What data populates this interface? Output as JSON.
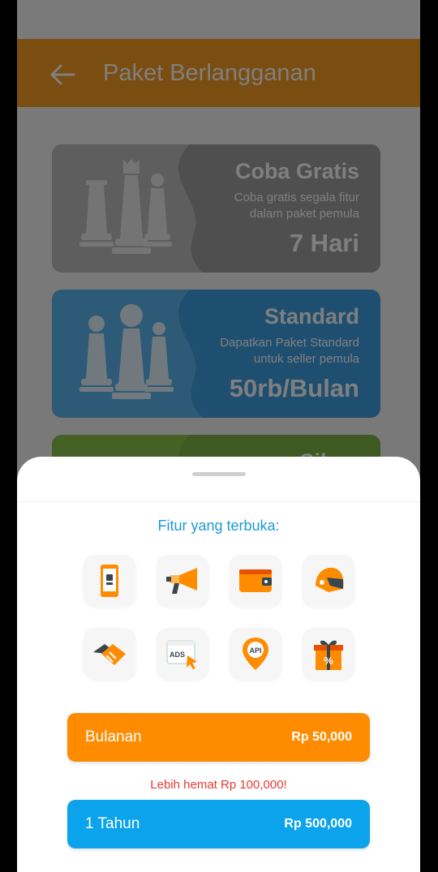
{
  "header": {
    "title": "Paket Berlangganan",
    "back_icon": "arrow-left-icon"
  },
  "plans": [
    {
      "name": "Coba Gratis",
      "desc_line1": "Coba gratis segala fitur",
      "desc_line2": "dalam paket pemula",
      "price": "7 Hari",
      "color": "#bdbdbd"
    },
    {
      "name": "Standard",
      "desc_line1": "Dapatkan Paket Standard",
      "desc_line2": "untuk seller pemula",
      "price": "50rb/Bulan",
      "color": "#5ab4ee"
    },
    {
      "name": "Silver",
      "color": "#8bc34a"
    }
  ],
  "sheet": {
    "features_title": "Fitur yang terbuka:",
    "features": [
      {
        "icon": "smartphone-icon"
      },
      {
        "icon": "megaphone-icon"
      },
      {
        "icon": "wallet-icon"
      },
      {
        "icon": "helmet-icon"
      },
      {
        "icon": "handshake-icon"
      },
      {
        "icon": "ads-icon",
        "label": "ADS"
      },
      {
        "icon": "api-location-icon",
        "label": "API"
      },
      {
        "icon": "gift-discount-icon",
        "label": "%"
      }
    ],
    "monthly": {
      "label": "Bulanan",
      "price": "Rp 50,000",
      "color": "#ff8c00"
    },
    "savings_text": "Lebih hemat Rp 100,000!",
    "yearly": {
      "label": "1  Tahun",
      "price": "Rp 500,000",
      "color": "#0aa3ec"
    }
  }
}
